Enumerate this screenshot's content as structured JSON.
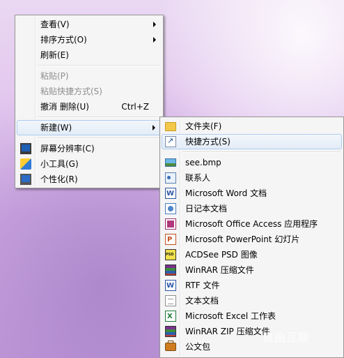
{
  "context_menu": {
    "items": [
      {
        "label": "查看(V)",
        "submenu": true
      },
      {
        "label": "排序方式(O)",
        "submenu": true
      },
      {
        "label": "刷新(E)"
      },
      {
        "label": "粘贴(P)",
        "disabled": true
      },
      {
        "label": "粘贴快捷方式(S)",
        "disabled": true
      },
      {
        "label": "撤消 删除(U)",
        "shortcut": "Ctrl+Z"
      },
      {
        "label": "新建(W)",
        "submenu": true,
        "highlighted": true
      },
      {
        "label": "屏幕分辨率(C)",
        "icon": "monitor-icon"
      },
      {
        "label": "小工具(G)",
        "icon": "gadget-icon"
      },
      {
        "label": "个性化(R)",
        "icon": "personalize-icon"
      }
    ]
  },
  "new_submenu": {
    "items": [
      {
        "label": "文件夹(F)",
        "icon": "folder-icon"
      },
      {
        "label": "快捷方式(S)",
        "icon": "shortcut-icon",
        "highlighted": true
      },
      {
        "label": "see.bmp",
        "icon": "bitmap-icon"
      },
      {
        "label": "联系人",
        "icon": "contact-icon"
      },
      {
        "label": "Microsoft Word 文档",
        "icon": "word-document-icon"
      },
      {
        "label": "日记本文档",
        "icon": "journal-document-icon"
      },
      {
        "label": "Microsoft Office Access 应用程序",
        "icon": "access-database-icon"
      },
      {
        "label": "Microsoft PowerPoint 幻灯片",
        "icon": "powerpoint-icon"
      },
      {
        "label": "ACDSee PSD 图像",
        "icon": "acdsee-psd-icon"
      },
      {
        "label": "WinRAR 压缩文件",
        "icon": "winrar-archive-icon"
      },
      {
        "label": "RTF 文件",
        "icon": "rtf-document-icon"
      },
      {
        "label": "文本文档",
        "icon": "text-document-icon"
      },
      {
        "label": "Microsoft Excel 工作表",
        "icon": "excel-worksheet-icon"
      },
      {
        "label": "WinRAR ZIP 压缩文件",
        "icon": "winrar-zip-icon"
      },
      {
        "label": "公文包",
        "icon": "briefcase-icon"
      }
    ]
  },
  "watermark": "自由互联"
}
